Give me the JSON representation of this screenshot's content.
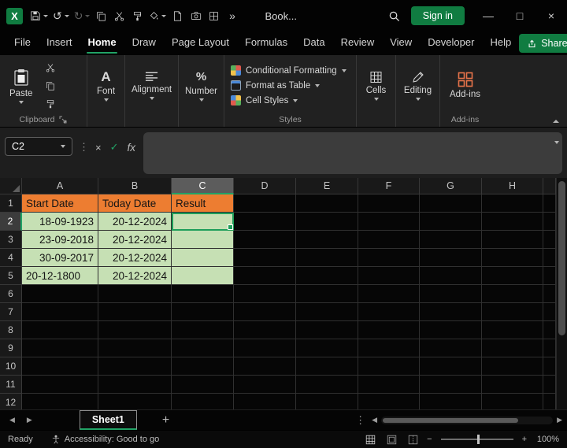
{
  "colors": {
    "accent_green": "#21A366",
    "sign_in_green": "#107C41",
    "header_fill_orange": "#ED7D31",
    "data_fill_green": "#C6E0B4",
    "selection_border_green": "#1E9E5A"
  },
  "titlebar": {
    "app_title": "Book...",
    "sign_in_label": "Sign in",
    "more_commands": "»",
    "window": {
      "minimize": "—",
      "maximize": "□",
      "close": "×"
    },
    "glyphs": {
      "undo": "↺",
      "redo": "↻"
    }
  },
  "menubar": {
    "tabs": [
      "File",
      "Insert",
      "Home",
      "Draw",
      "Page Layout",
      "Formulas",
      "Data",
      "Review",
      "View",
      "Developer",
      "Help"
    ],
    "active_tab": "Home",
    "share_label": "Share"
  },
  "ribbon": {
    "paste_label": "Paste",
    "font_label": "Font",
    "alignment_label": "Alignment",
    "number_label": "Number",
    "styles_items": [
      {
        "label": "Conditional Formatting",
        "icon": "conditional-formatting"
      },
      {
        "label": "Format as Table",
        "icon": "format-as-table"
      },
      {
        "label": "Cell Styles",
        "icon": "cell-styles"
      }
    ],
    "cells_label": "Cells",
    "editing_label": "Editing",
    "addins_label": "Add-ins",
    "group_labels": {
      "clipboard": "Clipboard",
      "styles": "Styles",
      "addins": "Add-ins"
    }
  },
  "formula_bar": {
    "name_box_value": "C2",
    "dots": "⋮",
    "cancel_glyph": "×",
    "enter_glyph": "✓",
    "fx_label": "fx",
    "formula_value": ""
  },
  "grid": {
    "column_headers": [
      "A",
      "B",
      "C",
      "D",
      "E",
      "F",
      "G",
      "H"
    ],
    "selected_column": "C",
    "selected_row": 2,
    "row_headers": [
      1,
      2,
      3,
      4,
      5,
      6,
      7,
      8,
      9,
      10,
      11,
      12
    ],
    "selected_cell": "C2",
    "cells": [
      {
        "ref": "A1",
        "text": "Start Date",
        "fill": "orange",
        "align": "left"
      },
      {
        "ref": "B1",
        "text": "Today Date",
        "fill": "orange",
        "align": "left"
      },
      {
        "ref": "C1",
        "text": "Result",
        "fill": "orange",
        "align": "left"
      },
      {
        "ref": "A2",
        "text": "18-09-1923",
        "fill": "green",
        "align": "right"
      },
      {
        "ref": "B2",
        "text": "20-12-2024",
        "fill": "green",
        "align": "right"
      },
      {
        "ref": "C2",
        "text": "",
        "fill": "green",
        "selected": true
      },
      {
        "ref": "A3",
        "text": "23-09-2018",
        "fill": "green",
        "align": "right"
      },
      {
        "ref": "B3",
        "text": "20-12-2024",
        "fill": "green",
        "align": "right"
      },
      {
        "ref": "C3",
        "text": "",
        "fill": "green"
      },
      {
        "ref": "A4",
        "text": "30-09-2017",
        "fill": "green",
        "align": "right"
      },
      {
        "ref": "B4",
        "text": "20-12-2024",
        "fill": "green",
        "align": "right"
      },
      {
        "ref": "C4",
        "text": "",
        "fill": "green"
      },
      {
        "ref": "A5",
        "text": "20-12-1800",
        "fill": "green",
        "align": "left"
      },
      {
        "ref": "B5",
        "text": "20-12-2024",
        "fill": "green",
        "align": "right"
      },
      {
        "ref": "C5",
        "text": "",
        "fill": "green"
      }
    ]
  },
  "sheet_bar": {
    "nav_left": "◀",
    "nav_right": "▶",
    "active_tab": "Sheet1",
    "add_sheet": "+",
    "more": "⋮"
  },
  "status_bar": {
    "ready_label": "Ready",
    "accessibility_label": "Accessibility: Good to go",
    "zoom_minus": "−",
    "zoom_plus": "+",
    "zoom_value": "100%"
  }
}
